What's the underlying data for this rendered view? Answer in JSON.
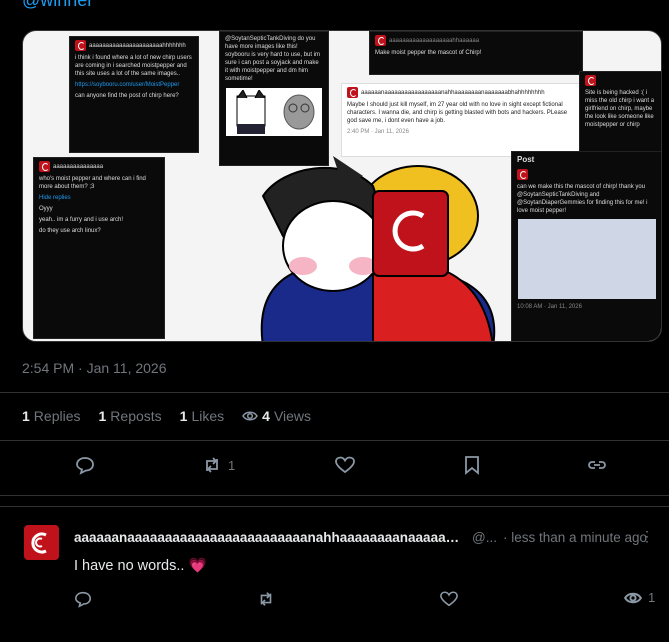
{
  "post": {
    "handle_partial": "@winner",
    "timestamp": "2:54 PM · Jan 11, 2026",
    "stats": {
      "replies_count": "1",
      "replies_label": "Replies",
      "reposts_count": "1",
      "reposts_label": "Reposts",
      "likes_count": "1",
      "likes_label": "Likes",
      "views_count": "4",
      "views_label": "Views"
    },
    "actions": {
      "repost_count": "1"
    }
  },
  "image_collage": {
    "shot1_name": "aaaaaaaaaaaaaaaaaaaaaahhhhhhh",
    "shot1_text": "i think i found where a lot of new chirp users are coming in i searched moistpepper and this site uses a lot of the same images..",
    "shot1_link": "https://soybooru.com/user/MoistPepper",
    "shot1_text2": "can anyone find the post of chirp here?",
    "shot2_text": "@SoytanSepticTankDiving do you have more images like this! soybooru is very hard to use, but im sure i can post a soyjack and make it with moistpepper and dm him sometime!",
    "shot3_text": "Make moist pepper the mascot of Chirp!",
    "shot4_name": "aaaaaanaaaaaaaaaaaaaaaaanahhaaaaaaaanaaaaaaabhahhhhhhhh",
    "shot4_text": "Maybe I should just kill myself, im 27 year old with no love in sight except fictional characters. I wanna die, and chirp is getting blasted with bots and hackers. PLease god save me, i dont even have a job.",
    "shot4_date": "2:40 PM · Jan 11, 2026",
    "shot5_text1": "who's moist pepper and where can i find more about them? ;3",
    "shot5_hide": "Hide replies",
    "shot5_oyyy": "Oyyy",
    "shot5_text2": "yeah.. im a furry and i use arch!",
    "shot5_text3": "do they use arch linux?",
    "shot6_title": "Post",
    "shot6_text": "can we make this the mascot of chirp! thank you @SoytanSepticTankDiving and @SoytanDiaperGemmies for finding this for me! i love moist pepper!",
    "shot6_date": "10:08 AM · Jan 11, 2026",
    "shot7_text": "Site is being hacked :( i miss the old chirp i want a girlfriend on chirp, maybe the look like someone like moistpepper or chirp"
  },
  "reply": {
    "name": "aaaaaanaaaaaaaaaaaaaaaaaaaaaaaanahhaaaaaaaanaaaaaaaabh...",
    "handle": "@...",
    "time": "· less than a minute ago",
    "more": "⋮",
    "text": "I have no words..",
    "emoji": "💗",
    "views": "1"
  }
}
